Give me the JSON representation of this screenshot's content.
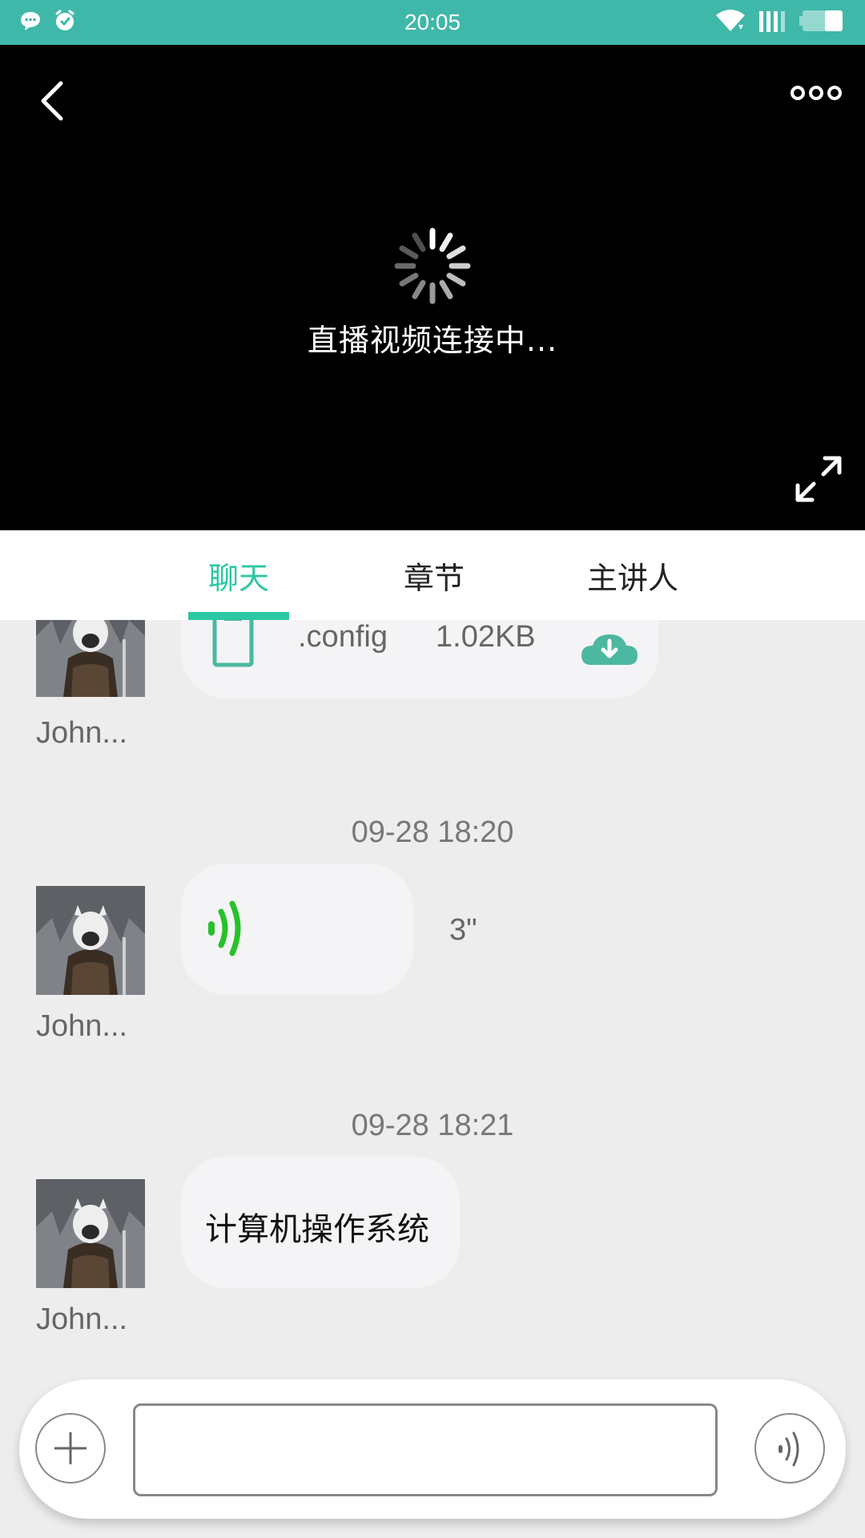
{
  "status_bar": {
    "time": "20:05",
    "left_icons": [
      "message-notification-icon",
      "alarm-icon"
    ],
    "right_icons": [
      "wifi-icon",
      "signal-icon",
      "battery-icon"
    ]
  },
  "video": {
    "loading_text": "直播视频连接中...",
    "icons": [
      "back-icon",
      "more-icon",
      "loading-spinner-icon",
      "fullscreen-icon"
    ]
  },
  "tabs": [
    {
      "label": "聊天",
      "active": true
    },
    {
      "label": "章节",
      "active": false
    },
    {
      "label": "主讲人",
      "active": false
    }
  ],
  "colors": {
    "accent": "#2cc7a3",
    "status_bar": "#3fb8a9",
    "voice_green": "#27c22b",
    "chat_bg": "#ededed",
    "bubble": "#f4f4f6"
  },
  "messages": [
    {
      "type": "file",
      "file_name": ".config",
      "file_size": "1.02KB",
      "username": "John..."
    },
    {
      "type": "voice",
      "timestamp": "09-28 18:20",
      "duration": "3\"",
      "username": "John..."
    },
    {
      "type": "text",
      "timestamp": "09-28 18:21",
      "text": "计算机操作系统",
      "username": "John..."
    }
  ],
  "input": {
    "value": "",
    "placeholder": ""
  }
}
